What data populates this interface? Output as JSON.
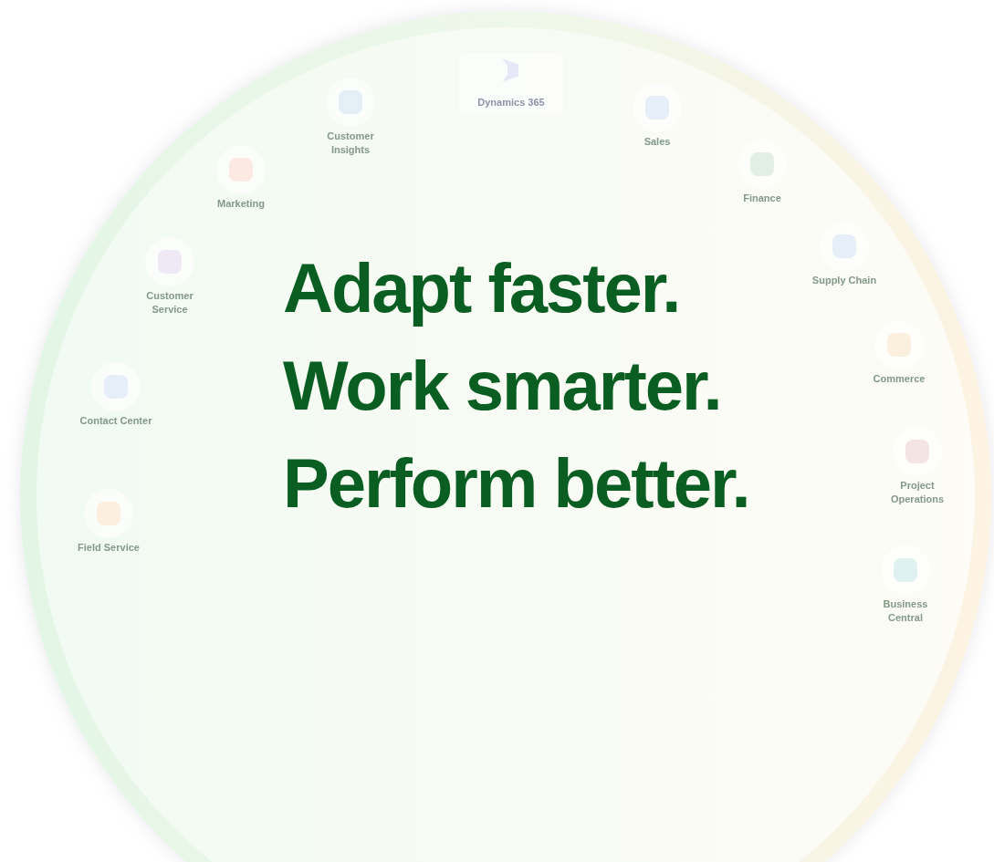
{
  "brand_tile": {
    "label": "Dynamics 365"
  },
  "apps": [
    {
      "label": "Customer Insights"
    },
    {
      "label": "Sales"
    },
    {
      "label": "Marketing"
    },
    {
      "label": "Finance"
    },
    {
      "label": "Customer Service"
    },
    {
      "label": "Supply Chain"
    },
    {
      "label": "Commerce"
    },
    {
      "label": "Contact Center"
    },
    {
      "label": "Project Operations"
    },
    {
      "label": "Field Service"
    },
    {
      "label": "Business Central"
    }
  ],
  "headline": [
    "Adapt faster.",
    "Work smarter.",
    "Perform better."
  ]
}
